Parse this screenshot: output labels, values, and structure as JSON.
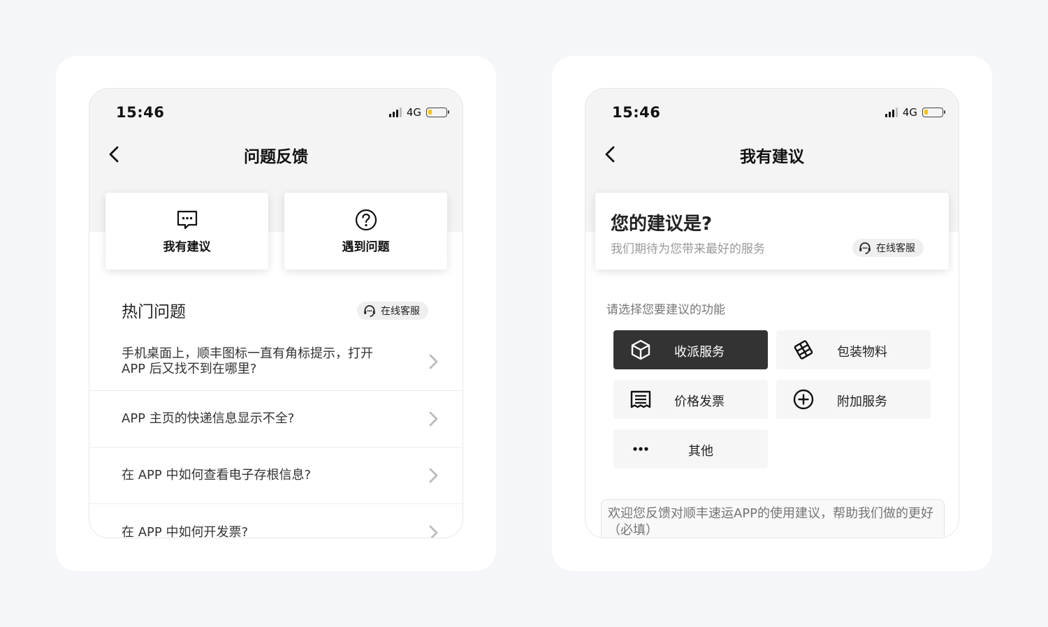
{
  "left": {
    "status": {
      "time": "15:46",
      "network": "4G"
    },
    "nav_title": "问题反馈",
    "tiles": [
      {
        "label": "我有建议",
        "icon": "chat-bubble-icon"
      },
      {
        "label": "遇到问题",
        "icon": "question-circle-icon"
      }
    ],
    "hot_title": "热门问题",
    "online_service": "在线客服",
    "faqs": [
      {
        "text": "手机桌面上，顺丰图标一直有角标提示，打开 APP 后又找不到在哪里?"
      },
      {
        "text": "APP 主页的快递信息显示不全?"
      },
      {
        "text": "在 APP 中如何查看电子存根信息?"
      },
      {
        "text": "在 APP 中如何开发票?"
      }
    ]
  },
  "right": {
    "status": {
      "time": "15:46",
      "network": "4G"
    },
    "nav_title": "我有建议",
    "question": "您的建议是?",
    "subtitle": "我们期待为您带来最好的服务",
    "online_service": "在线客服",
    "section_label": "请选择您要建议的功能",
    "options": [
      {
        "label": "收派服务",
        "icon": "package-box-icon",
        "selected": true
      },
      {
        "label": "包装物料",
        "icon": "packaging-icon",
        "selected": false
      },
      {
        "label": "价格发票",
        "icon": "receipt-icon",
        "selected": false
      },
      {
        "label": "附加服务",
        "icon": "plus-circle-icon",
        "selected": false
      },
      {
        "label": "其他",
        "icon": "more-dots-icon",
        "selected": false
      }
    ],
    "textarea_placeholder": "欢迎您反馈对顺丰速运APP的使用建议，帮助我们做的更好（必填）"
  },
  "colors": {
    "selected_bg": "#333333",
    "battery": "#f5c518",
    "page_bg": "#f5f6fa"
  }
}
